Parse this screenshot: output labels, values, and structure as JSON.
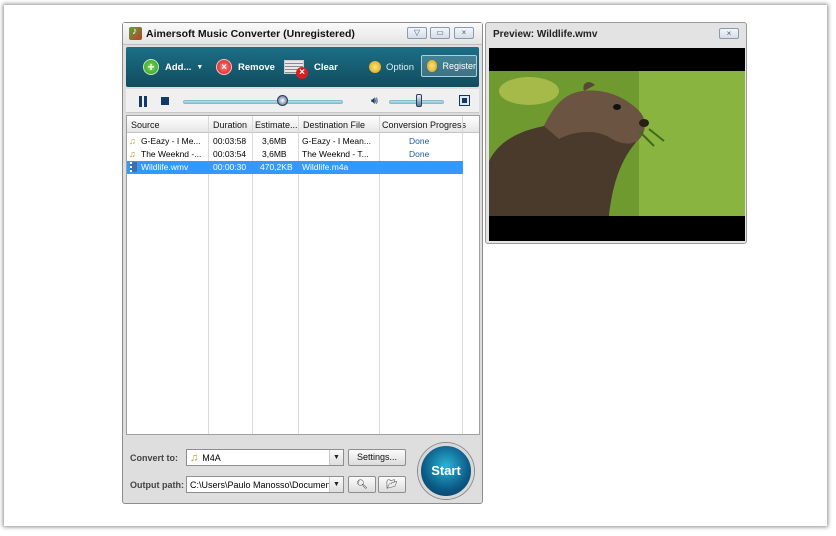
{
  "app": {
    "title": "Aimersoft Music Converter (Unregistered)",
    "window_buttons": [
      "▽",
      "▭",
      "×"
    ]
  },
  "toolbar": {
    "add_label": "Add...",
    "remove_label": "Remove",
    "clear_label": "Clear",
    "option_label": "Option",
    "register_label": "Register"
  },
  "playback": {
    "progress": 0.62,
    "volume": 0.55
  },
  "file_list": {
    "columns": [
      "Source",
      "Duration",
      "Estimate...",
      "Destination File",
      "Conversion Progress"
    ],
    "rows": [
      {
        "icon": "music-note-icon",
        "source": "G-Eazy - I Me...",
        "duration": "00:03:58",
        "estimate": "3,6MB",
        "destination": "G-Eazy - I Mean...",
        "progress": "Done"
      },
      {
        "icon": "music-note-icon",
        "source": "The Weeknd -...",
        "duration": "00:03:54",
        "estimate": "3,6MB",
        "destination": "The Weeknd - T...",
        "progress": "Done"
      },
      {
        "icon": "film-icon",
        "source": "Wildlife.wmv",
        "duration": "00:00:30",
        "estimate": "470,2KB",
        "destination": "Wildlife.m4a",
        "progress": ""
      }
    ]
  },
  "bottom": {
    "convert_to_label": "Convert to:",
    "convert_to_value": "M4A",
    "settings_label": "Settings...",
    "output_path_label": "Output path:",
    "output_path_value": "C:\\Users\\Paulo Manosso\\Documents",
    "start_label": "Start"
  },
  "preview": {
    "title": "Preview: Wildlife.wmv",
    "close": "×"
  },
  "colors": {
    "toolbar": "#1b6f86",
    "selection": "#3399ff",
    "done_text": "#1e5aa8",
    "start_button": "#0b5a86"
  }
}
